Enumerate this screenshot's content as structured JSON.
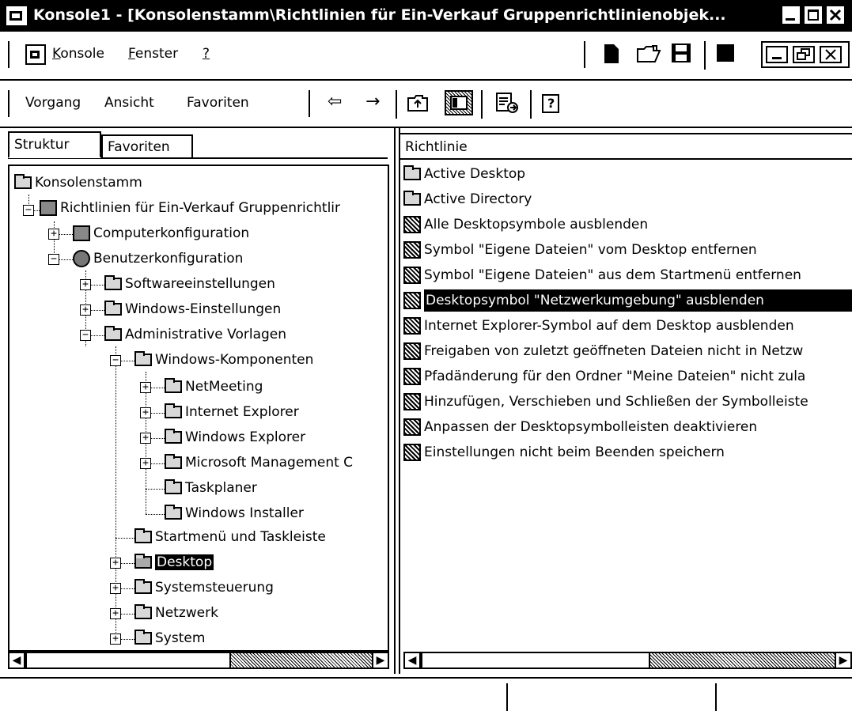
{
  "window": {
    "title": "Konsole1 - [Konsolenstamm\\Richtlinien für Ein-Verkauf Gruppenrichtlinienobjek...",
    "controls": [
      "_",
      "□",
      "✕"
    ]
  },
  "menubar": {
    "items": [
      "Konsole",
      "Fenster",
      "?"
    ],
    "mnemonics": [
      "K",
      "F",
      "?"
    ]
  },
  "toolbar": {
    "items": [
      "Vorgang",
      "Ansicht",
      "Favoriten"
    ],
    "back_label": "⇦",
    "forward_label": "→"
  },
  "tabs": [
    "Struktur",
    "Favoriten"
  ],
  "tree": {
    "root": "Konsolenstamm",
    "gpo": "Richtlinien für Ein-Verkauf Gruppenrichtlir",
    "computer": "Computerkonfiguration",
    "user": "Benutzerkonfiguration",
    "software": "Softwareeinstellungen",
    "windows_settings": "Windows-Einstellungen",
    "admin_templates": "Administrative Vorlagen",
    "windows_components": "Windows-Komponenten",
    "netmeeting": "NetMeeting",
    "ie": "Internet Explorer",
    "win_explorer": "Windows Explorer",
    "mmc": "Microsoft Management C",
    "taskplaner": "Taskplaner",
    "installer": "Windows Installer",
    "startmenu": "Startmenü und Taskleiste",
    "desktop": "Desktop",
    "controlpanel": "Systemsteuerung",
    "network": "Netzwerk",
    "system": "System"
  },
  "list": {
    "header": "Richtlinie",
    "items": [
      "Active Desktop",
      "Active Directory",
      "Alle Desktopsymbole ausblenden",
      "Symbol \"Eigene Dateien\" vom Desktop entfernen",
      "Symbol \"Eigene Dateien\" aus dem Startmenü entfernen",
      "Desktopsymbol \"Netzwerkumgebung\" ausblenden",
      "Internet Explorer-Symbol auf dem Desktop ausblenden",
      "Freigaben von zuletzt geöffneten Dateien nicht in Netzw",
      "Pfadänderung für den Ordner \"Meine Dateien\" nicht zula",
      "Hinzufügen, Verschieben und Schließen der Symbolleiste",
      "Anpassen der Desktopsymbolleisten deaktivieren",
      "Einstellungen nicht beim Beenden speichern"
    ]
  },
  "colors": {
    "selection": "#000000",
    "background": "#ffffff"
  }
}
